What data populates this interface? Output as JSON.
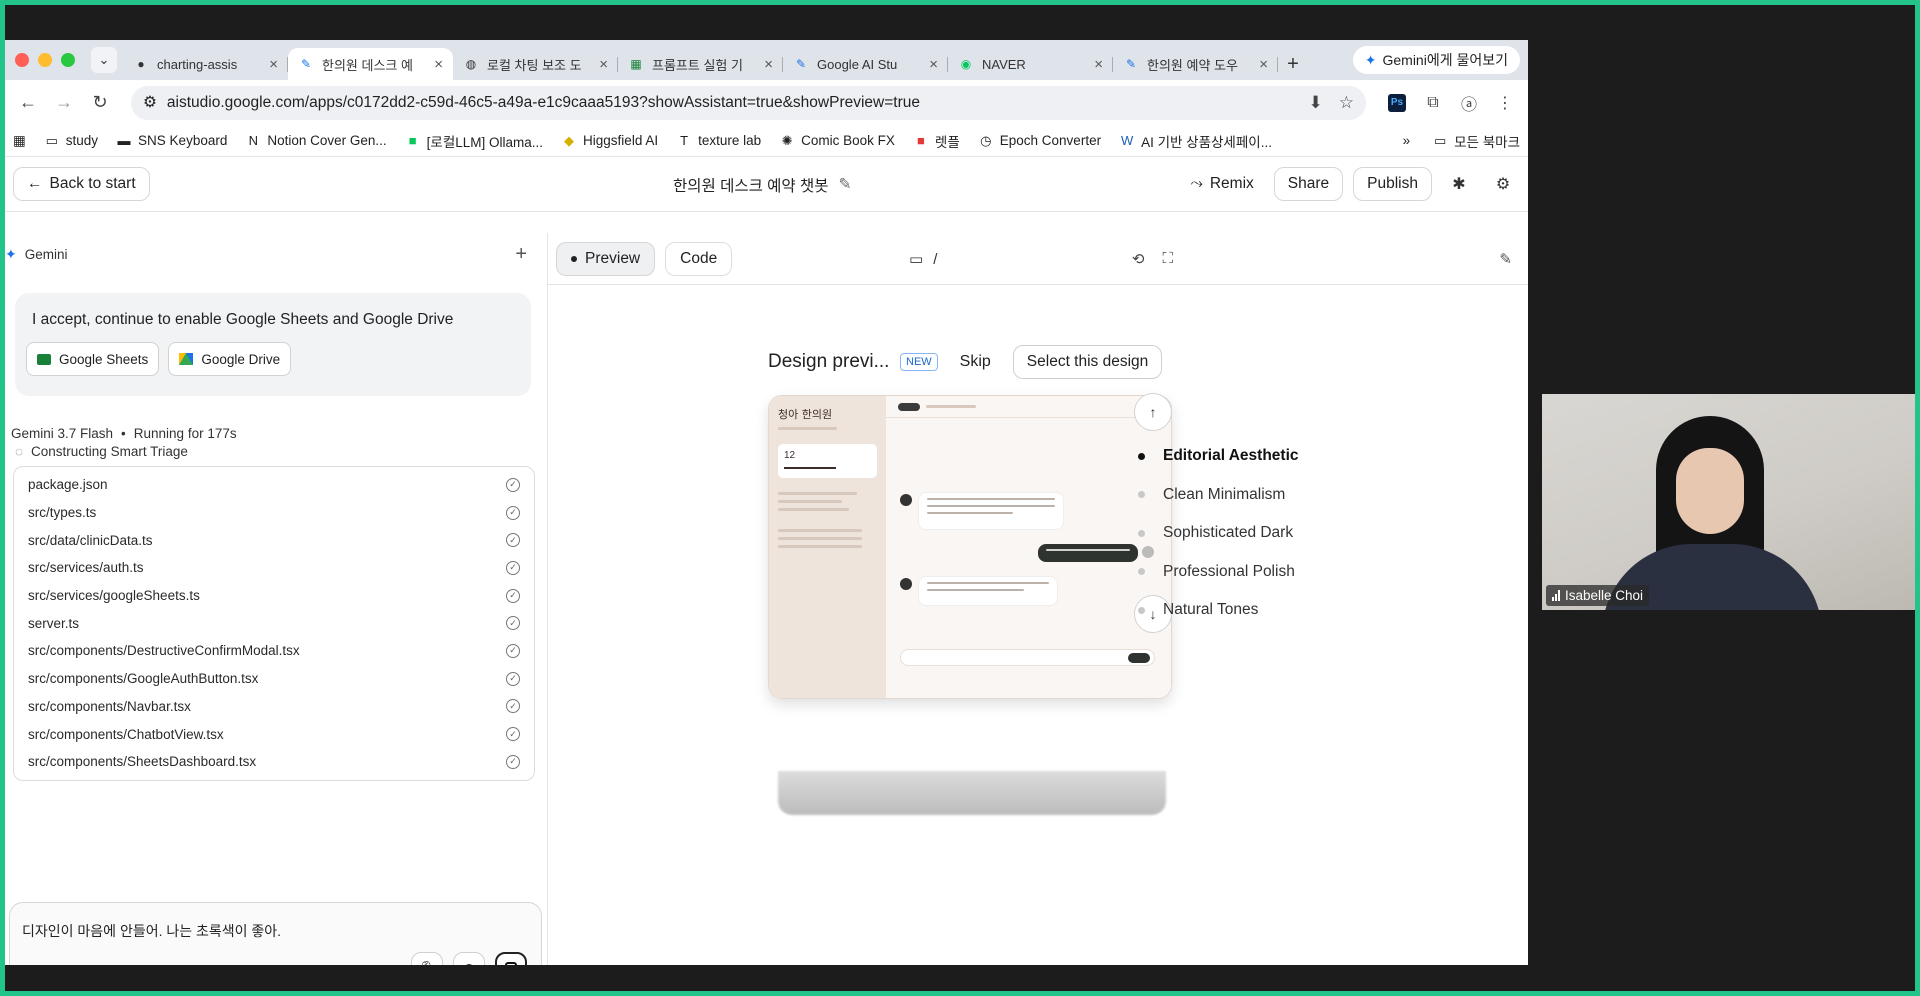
{
  "tabs": [
    {
      "title": "charting-assis",
      "icon": "github-icon",
      "active": false
    },
    {
      "title": "한의원 데스크 예",
      "icon": "ai-studio-icon",
      "active": true
    },
    {
      "title": "로컬 차팅 보조 도",
      "icon": "globe-icon",
      "active": false
    },
    {
      "title": "프롬프트 실험 기",
      "icon": "sheets-icon",
      "active": false
    },
    {
      "title": "Google AI Stu",
      "icon": "ai-studio-icon",
      "active": false
    },
    {
      "title": "NAVER",
      "icon": "naver-icon",
      "active": false
    },
    {
      "title": "한의원 예약 도우",
      "icon": "ai-studio-icon",
      "active": false
    }
  ],
  "gemini_pill": "Gemini에게 물어보기",
  "address_bar": {
    "url": "aistudio.google.com/apps/c0172dd2-c59d-46c5-a49a-e1c9caaa5193?showAssistant=true&showPreview=true"
  },
  "bookmarks": [
    {
      "label": "study",
      "icon": "folder-icon"
    },
    {
      "label": "SNS Keyboard",
      "icon": "car-icon"
    },
    {
      "label": "Notion Cover Gen...",
      "icon": "notion-icon"
    },
    {
      "label": "[로컬LLM] Ollama...",
      "icon": "blog-icon"
    },
    {
      "label": "Higgsfield AI",
      "icon": "higgsfield-icon"
    },
    {
      "label": "texture lab",
      "icon": "texture-icon"
    },
    {
      "label": "Comic Book FX",
      "icon": "comic-icon"
    },
    {
      "label": "렛플",
      "icon": "let-icon"
    },
    {
      "label": "Epoch Converter",
      "icon": "clock-icon"
    },
    {
      "label": "AI 기반 상품상세페이...",
      "icon": "word-icon"
    }
  ],
  "bookmarks_all": "모든 북마크",
  "appbar": {
    "back_label": "Back to start",
    "project_title": "한의원 데스크 예약 챗봇",
    "remix_label": "Remix",
    "share_label": "Share",
    "publish_label": "Publish"
  },
  "chat": {
    "header": "Gemini",
    "accept_message": "I accept, continue to enable Google Sheets and Google Drive",
    "chips": [
      "Google Sheets",
      "Google Drive"
    ],
    "model": "Gemini 3.7 Flash",
    "running": "Running for 177s",
    "step": "Constructing Smart Triage",
    "files": [
      "package.json",
      "src/types.ts",
      "src/data/clinicData.ts",
      "src/services/auth.ts",
      "src/services/googleSheets.ts",
      "server.ts",
      "src/components/DestructiveConfirmModal.tsx",
      "src/components/GoogleAuthButton.tsx",
      "src/components/Navbar.tsx",
      "src/components/ChatbotView.tsx",
      "src/components/SheetsDashboard.tsx"
    ],
    "composer_text": "디자인이 마음에 안들어. 나는 초록색이 좋아."
  },
  "preview": {
    "tab_preview": "Preview",
    "tab_code": "Code",
    "path": "/",
    "design_title": "Design previ...",
    "new_badge": "NEW",
    "skip_label": "Skip",
    "select_label": "Select this design",
    "styles": [
      "Editorial Aesthetic",
      "Clean Minimalism",
      "Sophisticated Dark",
      "Professional Polish",
      "Natural Tones"
    ],
    "selected_style": "Editorial Aesthetic",
    "mock": {
      "brand": "청아 한의원",
      "number": "12"
    }
  },
  "webcam": {
    "name": "Isabelle Choi"
  },
  "colors": {
    "frame": "#22c48a",
    "accent": "#1a73e8",
    "mock_sidebar": "#efe4dc"
  }
}
